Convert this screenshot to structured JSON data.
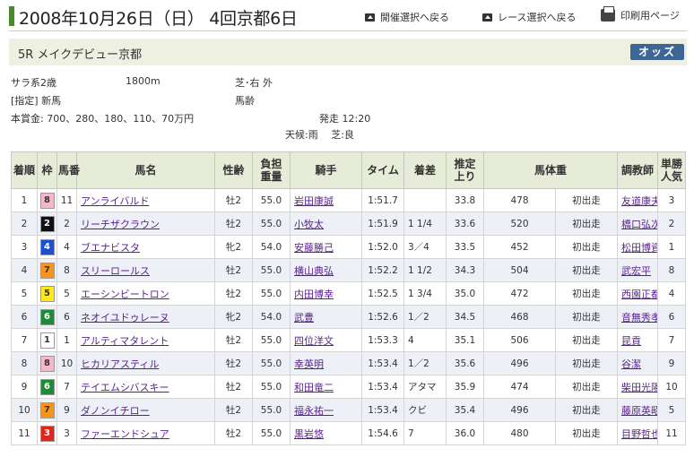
{
  "header": {
    "date_title": "2008年10月26日（日） 4回京都6日",
    "nav_kaisai": "開催選択へ戻る",
    "nav_race": "レース選択へ戻る",
    "nav_print": "印刷用ページ"
  },
  "race": {
    "name": "5R メイクデビュー京都",
    "odds_label": "オッズ",
    "category": "サラ系2歳",
    "distance": "1800m",
    "surface": "芝･右 外",
    "condition": "[指定] 新馬",
    "weight_rule": "馬齢",
    "prize": "本賞金: 700、280、180、110、70万円",
    "start_time": "発走 12:20",
    "weather": "天候:雨　 芝:良"
  },
  "table": {
    "headers": {
      "rank": "着順",
      "waku": "枠",
      "umaban": "馬番",
      "horse": "馬名",
      "sexage": "性齢",
      "weight": "負担重量",
      "jockey": "騎手",
      "time": "タイム",
      "margin": "着差",
      "last3f": "推定上り",
      "body_weight": "馬体重",
      "trainer": "調教師",
      "pop": "単勝人気"
    },
    "rows": [
      {
        "rank": "1",
        "waku": "8",
        "umaban": "11",
        "horse": "アンライバルド",
        "sexage": "牡2",
        "weight": "55.0",
        "jockey": "岩田康誠",
        "time": "1:51.7",
        "margin": "",
        "last3f": "33.8",
        "body_weight": "478",
        "change": "初出走",
        "trainer": "友道康夫",
        "pop": "3"
      },
      {
        "rank": "2",
        "waku": "2",
        "umaban": "2",
        "horse": "リーチザクラウン",
        "sexage": "牡2",
        "weight": "55.0",
        "jockey": "小牧太",
        "time": "1:51.9",
        "margin": "1 1/4",
        "last3f": "33.6",
        "body_weight": "520",
        "change": "初出走",
        "trainer": "橋口弘次郎",
        "pop": "2"
      },
      {
        "rank": "3",
        "waku": "4",
        "umaban": "4",
        "horse": "ブエナビスタ",
        "sexage": "牝2",
        "weight": "54.0",
        "jockey": "安藤勝己",
        "time": "1:52.0",
        "margin": "3／4",
        "last3f": "33.5",
        "body_weight": "452",
        "change": "初出走",
        "trainer": "松田博資",
        "pop": "1"
      },
      {
        "rank": "4",
        "waku": "7",
        "umaban": "8",
        "horse": "スリーロールス",
        "sexage": "牡2",
        "weight": "55.0",
        "jockey": "横山典弘",
        "time": "1:52.2",
        "margin": "1 1/2",
        "last3f": "34.3",
        "body_weight": "504",
        "change": "初出走",
        "trainer": "武宏平",
        "pop": "8"
      },
      {
        "rank": "5",
        "waku": "5",
        "umaban": "5",
        "horse": "エーシンビートロン",
        "sexage": "牡2",
        "weight": "55.0",
        "jockey": "内田博幸",
        "time": "1:52.5",
        "margin": "1 3/4",
        "last3f": "35.0",
        "body_weight": "472",
        "change": "初出走",
        "trainer": "西園正都",
        "pop": "4"
      },
      {
        "rank": "6",
        "waku": "6",
        "umaban": "6",
        "horse": "ネオイユドゥレーヌ",
        "sexage": "牝2",
        "weight": "54.0",
        "jockey": "武豊",
        "time": "1:52.6",
        "margin": "1／2",
        "last3f": "34.5",
        "body_weight": "468",
        "change": "初出走",
        "trainer": "音無秀孝",
        "pop": "6"
      },
      {
        "rank": "7",
        "waku": "1",
        "umaban": "1",
        "horse": "アルティマタレント",
        "sexage": "牡2",
        "weight": "55.0",
        "jockey": "四位洋文",
        "time": "1:53.3",
        "margin": "4",
        "last3f": "35.1",
        "body_weight": "506",
        "change": "初出走",
        "trainer": "昆貢",
        "pop": "7"
      },
      {
        "rank": "8",
        "waku": "8",
        "umaban": "10",
        "horse": "ヒカリアスティル",
        "sexage": "牡2",
        "weight": "55.0",
        "jockey": "幸英明",
        "time": "1:53.4",
        "margin": "1／2",
        "last3f": "35.6",
        "body_weight": "496",
        "change": "初出走",
        "trainer": "谷潔",
        "pop": "9"
      },
      {
        "rank": "9",
        "waku": "6",
        "umaban": "7",
        "horse": "テイエムシバスキー",
        "sexage": "牡2",
        "weight": "55.0",
        "jockey": "和田竜二",
        "time": "1:53.4",
        "margin": "アタマ",
        "last3f": "35.9",
        "body_weight": "474",
        "change": "初出走",
        "trainer": "柴田光陽",
        "pop": "10"
      },
      {
        "rank": "10",
        "waku": "7",
        "umaban": "9",
        "horse": "ダノンイチロー",
        "sexage": "牡2",
        "weight": "55.0",
        "jockey": "福永祐一",
        "time": "1:53.4",
        "margin": "クビ",
        "last3f": "35.4",
        "body_weight": "496",
        "change": "初出走",
        "trainer": "藤原英昭",
        "pop": "5"
      },
      {
        "rank": "11",
        "waku": "3",
        "umaban": "3",
        "horse": "ファーエンドシュア",
        "sexage": "牡2",
        "weight": "55.0",
        "jockey": "黒岩悠",
        "time": "1:54.6",
        "margin": "7",
        "last3f": "36.0",
        "body_weight": "480",
        "change": "初出走",
        "trainer": "目野哲也",
        "pop": "11"
      }
    ]
  },
  "waku_colors": {
    "1": {
      "bg": "#ffffff",
      "fg": "#333333"
    },
    "2": {
      "bg": "#111111",
      "fg": "#ffffff"
    },
    "3": {
      "bg": "#e0251b",
      "fg": "#ffffff"
    },
    "4": {
      "bg": "#1a4fd6",
      "fg": "#ffffff"
    },
    "5": {
      "bg": "#ffe81a",
      "fg": "#333333"
    },
    "6": {
      "bg": "#1f8a3a",
      "fg": "#ffffff"
    },
    "7": {
      "bg": "#f7941d",
      "fg": "#333333"
    },
    "8": {
      "bg": "#f7b7c8",
      "fg": "#333333"
    }
  }
}
